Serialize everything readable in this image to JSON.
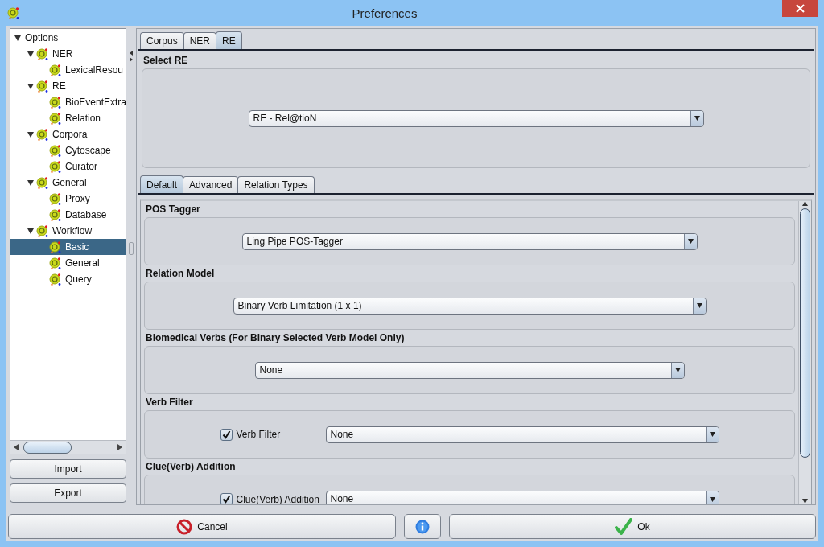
{
  "window": {
    "title": "Preferences"
  },
  "tree": {
    "label": "Options",
    "expanded": true,
    "selected": false,
    "children": [
      {
        "label": "NER",
        "expanded": true,
        "selected": false,
        "children": [
          {
            "label": "LexicalResou",
            "selected": false
          }
        ]
      },
      {
        "label": "RE",
        "expanded": true,
        "selected": false,
        "children": [
          {
            "label": "BioEventExtra",
            "selected": false
          },
          {
            "label": "Relation",
            "selected": false
          }
        ]
      },
      {
        "label": "Corpora",
        "expanded": true,
        "selected": false,
        "children": [
          {
            "label": "Cytoscape",
            "selected": false
          },
          {
            "label": "Curator",
            "selected": false
          }
        ]
      },
      {
        "label": "General",
        "expanded": true,
        "selected": false,
        "children": [
          {
            "label": "Proxy",
            "selected": false
          },
          {
            "label": "Database",
            "selected": false
          }
        ]
      },
      {
        "label": "Workflow",
        "expanded": true,
        "selected": false,
        "children": [
          {
            "label": "Basic",
            "selected": true
          },
          {
            "label": "General",
            "selected": false
          },
          {
            "label": "Query",
            "selected": false
          }
        ]
      }
    ]
  },
  "side_buttons": [
    "Import",
    "Export"
  ],
  "top_tabs": [
    {
      "label": "Corpus",
      "selected": false
    },
    {
      "label": "NER",
      "selected": false
    },
    {
      "label": "RE",
      "selected": true
    }
  ],
  "select_re": {
    "title": "Select RE",
    "value": "RE - Rel@tioN"
  },
  "sub_tabs": [
    {
      "label": "Default",
      "selected": true
    },
    {
      "label": "Advanced",
      "selected": false
    },
    {
      "label": "Relation Types",
      "selected": false
    }
  ],
  "sections": [
    {
      "title": "POS Tagger",
      "kind": "combo",
      "value": "Ling Pipe POS-Tagger"
    },
    {
      "title": "Relation Model",
      "kind": "combo",
      "value": "Binary Verb Limitation (1 x 1)"
    },
    {
      "title": "Biomedical Verbs (For Binary Selected Verb Model Only)",
      "kind": "combo",
      "value": "None"
    },
    {
      "title": "Verb Filter",
      "kind": "check-combo",
      "check_label": "Verb Filter",
      "checked": true,
      "value": "None"
    },
    {
      "title": "Clue(Verb) Addition",
      "kind": "check-combo",
      "check_label": "Clue(Verb) Addition",
      "checked": true,
      "value": "None"
    }
  ],
  "footer": [
    {
      "kind": "cancel",
      "label": "Cancel"
    },
    {
      "kind": "info"
    },
    {
      "kind": "ok",
      "label": "Ok"
    }
  ]
}
